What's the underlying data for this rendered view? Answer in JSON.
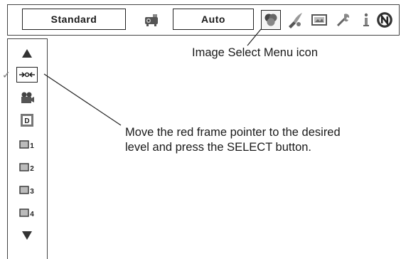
{
  "topbar": {
    "mode_value": "Standard",
    "setting_value": "Auto",
    "icons": [
      "projector-icon",
      "image-select-icon",
      "image-adjust-icon",
      "screen-icon",
      "setting-icon",
      "info-icon",
      "network-icon"
    ]
  },
  "sidebar": {
    "items": [
      "arrow-up-icon",
      "image-mode-auto-icon",
      "cinema-icon",
      "dynamic-icon",
      "image-1-icon",
      "image-2-icon",
      "image-3-icon",
      "image-4-icon",
      "arrow-down-icon"
    ],
    "selected_index": 1,
    "labels": [
      "1",
      "2",
      "3",
      "4"
    ],
    "dynamic_letter": "D"
  },
  "annotations": {
    "menu_icon_label": "Image Select Menu icon",
    "instruction_line1": "Move the red frame pointer to the desired",
    "instruction_line2": "level and press the SELECT button."
  },
  "colors": {
    "border": "#444444",
    "text": "#1a1a1a",
    "leader_line": "#222222"
  }
}
